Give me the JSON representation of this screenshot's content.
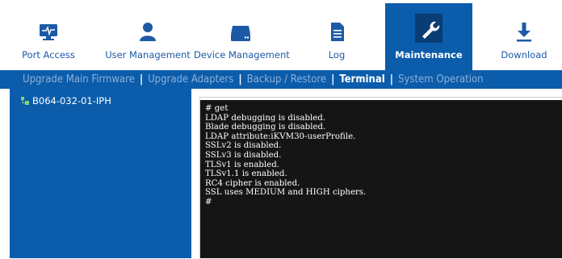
{
  "nav": {
    "items": [
      {
        "label": "Port Access",
        "icon": "monitor-pulse-icon"
      },
      {
        "label": "User Management",
        "icon": "user-icon"
      },
      {
        "label": "Device Management",
        "icon": "device-drive-icon"
      },
      {
        "label": "Log",
        "icon": "document-icon"
      },
      {
        "label": "Maintenance",
        "icon": "wrench-icon"
      },
      {
        "label": "Download",
        "icon": "download-icon"
      }
    ],
    "active": "Maintenance"
  },
  "subnav": {
    "tabs": [
      "Upgrade Main Firmware",
      "Upgrade Adapters",
      "Backup / Restore",
      "Terminal",
      "System Operation"
    ],
    "separator": "|",
    "active": "Terminal"
  },
  "sidebar": {
    "device": "B064-032-01-IPH"
  },
  "terminal": {
    "lines": [
      "# get",
      "LDAP debugging is disabled.",
      "Blade debugging is disabled.",
      "LDAP attribute:iKVM30-userProfile.",
      "SSLv2 is disabled.",
      "SSLv3 is disabled.",
      "TLSv1 is enabled.",
      "TLSv1.1 is enabled.",
      "RC4 cipher is enabled.",
      "SSL uses MEDIUM and HIGH ciphers.",
      "#"
    ]
  },
  "colors": {
    "brand_blue": "#0b5cab",
    "active_icon_bg": "#0a3d73",
    "inactive_subnav_text": "#8db0d8",
    "terminal_bg": "#151515"
  }
}
